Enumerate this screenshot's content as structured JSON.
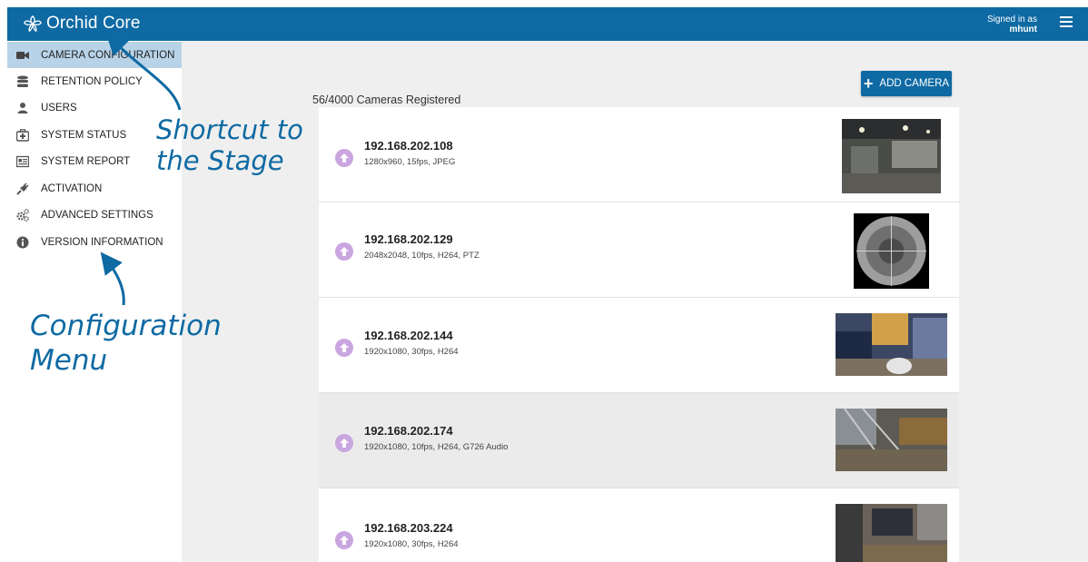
{
  "app": {
    "title": "Orchid Core",
    "signed_in_label": "Signed in as",
    "username": "mhunt"
  },
  "sidebar": {
    "items": [
      {
        "label": "CAMERA CONFIGURATION",
        "icon": "video-camera-icon",
        "active": true
      },
      {
        "label": "RETENTION POLICY",
        "icon": "database-icon"
      },
      {
        "label": "USERS",
        "icon": "user-icon"
      },
      {
        "label": "SYSTEM STATUS",
        "icon": "medkit-icon"
      },
      {
        "label": "SYSTEM REPORT",
        "icon": "report-icon"
      },
      {
        "label": "ACTIVATION",
        "icon": "plug-icon"
      },
      {
        "label": "ADVANCED SETTINGS",
        "icon": "gears-icon"
      },
      {
        "label": "VERSION INFORMATION",
        "icon": "info-icon"
      }
    ]
  },
  "main": {
    "count": "56/4000 Cameras Registered",
    "add_camera_label": "ADD CAMERA",
    "cameras": [
      {
        "ip": "192.168.202.108",
        "meta": "1280x960, 15fps, JPEG"
      },
      {
        "ip": "192.168.202.129",
        "meta": "2048x2048, 10fps, H264, PTZ"
      },
      {
        "ip": "192.168.202.144",
        "meta": "1920x1080, 30fps, H264"
      },
      {
        "ip": "192.168.202.174",
        "meta": "1920x1080, 10fps, H264, G726 Audio",
        "highlighted": true
      },
      {
        "ip": "192.168.203.224",
        "meta": "1920x1080, 30fps, H264"
      }
    ]
  },
  "annotations": {
    "shortcut_line1": "Shortcut to",
    "shortcut_line2": "the Stage",
    "config_line1": "Configuration",
    "config_line2": "Menu"
  },
  "colors": {
    "brand": "#0f6aa3",
    "active_menu": "#b8d3e8",
    "upload_button": "#c9a6e0"
  }
}
